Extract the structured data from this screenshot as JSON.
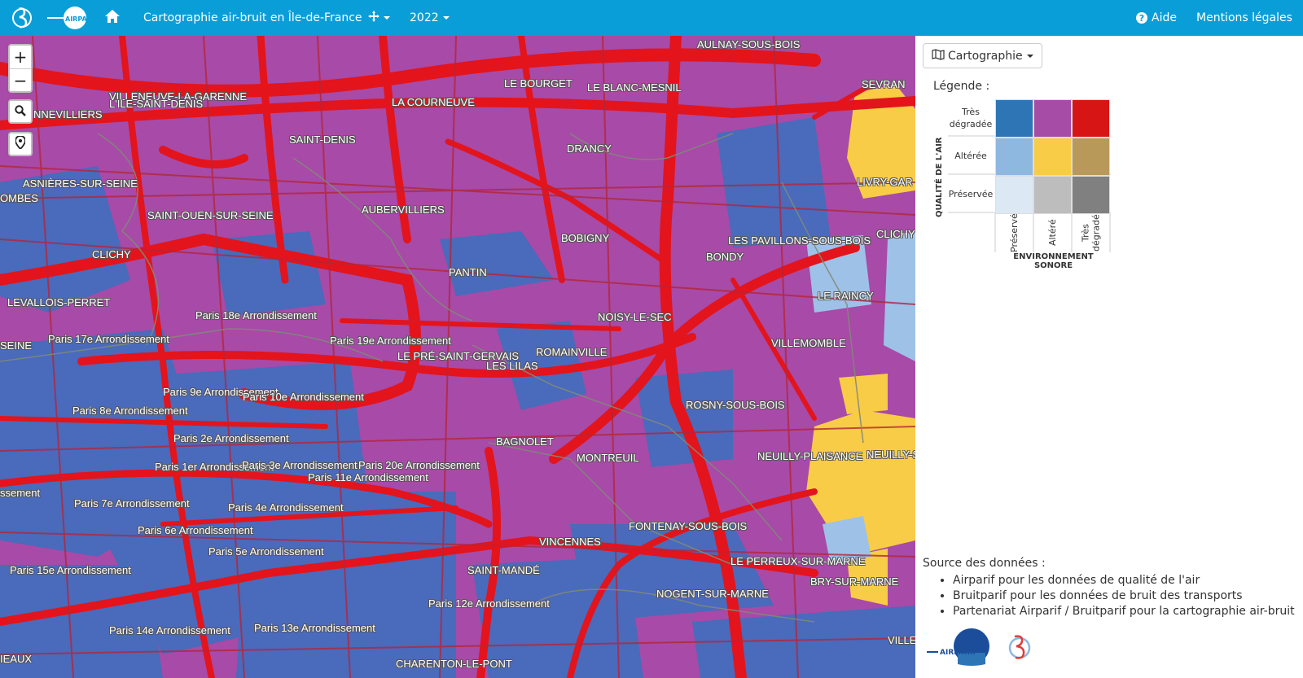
{
  "navbar": {
    "title": "Cartographie air-bruit en Île-de-France",
    "year": "2022",
    "help_label": "Aide",
    "legal_label": "Mentions légales",
    "logo_airparif_text": "AIRPARIF",
    "icons": [
      "bruitparif-logo-icon",
      "airparif-logo-icon",
      "home-icon",
      "layers-icon",
      "question-circle-icon"
    ]
  },
  "map": {
    "zoom_in": "+",
    "zoom_out": "−",
    "labels": [
      "AULNAY-SOUS-BOIS",
      "SEVRAN",
      "LE BOURGET",
      "LE BLANC-MESNIL",
      "VILLENEUVE-LA-GARENNE",
      "L'ILE-SAINT-DENIS",
      "NNEVILLIERS",
      "LA COURNEUVE",
      "SAINT-DENIS",
      "DRANCY",
      "ASNIÈRES-SUR-SEINE",
      "LIVRY-GAR",
      "OMBES",
      "AUBERVILLIERS",
      "SAINT-OUEN-SUR-SEINE",
      "BOBIGNY",
      "LES PAVILLONS-SOUS-BOIS",
      "CLICHY",
      "CLICHY",
      "BONDY",
      "PANTIN",
      "LE RAINCY",
      "LEVALLOIS-PERRET",
      "Paris 18e Arrondissement",
      "NOISY-LE-SEC",
      "SEINE",
      "Paris 17e Arrondissement",
      "Paris 19e Arrondissement",
      "VILLEMOMBLE",
      "LE PRÉ-SAINT-GERVAIS",
      "ROMAINVILLE",
      "LES LILAS",
      "Paris 9e Arrondissement",
      "Paris 10e Arrondissement",
      "ROSNY-SOUS-BOIS",
      "Paris 8e Arrondissement",
      "Paris 2e Arrondissement",
      "BAGNOLET",
      "MONTREUIL",
      "NEUILLY-PLAISANCE",
      "NEUILLY-S",
      "Paris 1er Arrondissement",
      "Paris 3e Arrondissement",
      "Paris 20e Arrondissement",
      "Paris 11e Arrondissement",
      "ssement",
      "Paris 7e Arrondissement",
      "Paris 4e Arrondissement",
      "FONTENAY-SOUS-BOIS",
      "Paris 6e Arrondissement",
      "VINCENNES",
      "Paris 5e Arrondissement",
      "LE PERREUX-SUR-MARNE",
      "Paris 15e Arrondissement",
      "SAINT-MANDÉ",
      "BRY-SUR-MARNE",
      "NOGENT-SUR-MARNE",
      "Paris 12e Arrondissement",
      "Paris 14e Arrondissement",
      "Paris 13e Arrondissement",
      "VILLE",
      "IEAUX",
      "CHARENTON-LE-PONT"
    ]
  },
  "panel": {
    "carto_label": "Cartographie",
    "legend_title": "Légende :",
    "axis_y": "QUALITÉ DE L'AIR",
    "axis_x": "ENVIRONNEMENT SONORE",
    "rows": [
      "Très dégradée",
      "Altérée",
      "Préservée"
    ],
    "cols": [
      "Préservé",
      "Altéré",
      "Très dégradé"
    ],
    "colors": [
      [
        "#2e75b6",
        "#a64ca6",
        "#d81515"
      ],
      [
        "#8eb8e0",
        "#f8cc46",
        "#b9995a"
      ],
      [
        "#dce9f5",
        "#bdbdbd",
        "#808080"
      ]
    ],
    "sources_title": "Source des données :",
    "sources": [
      "Airparif pour les données de qualité de l'air",
      "Bruitparif pour les données de bruit des transports",
      "Partenariat Airparif / Bruitparif pour la cartographie air-bruit"
    ],
    "logo_airparif_text": "AIRPARIF"
  }
}
